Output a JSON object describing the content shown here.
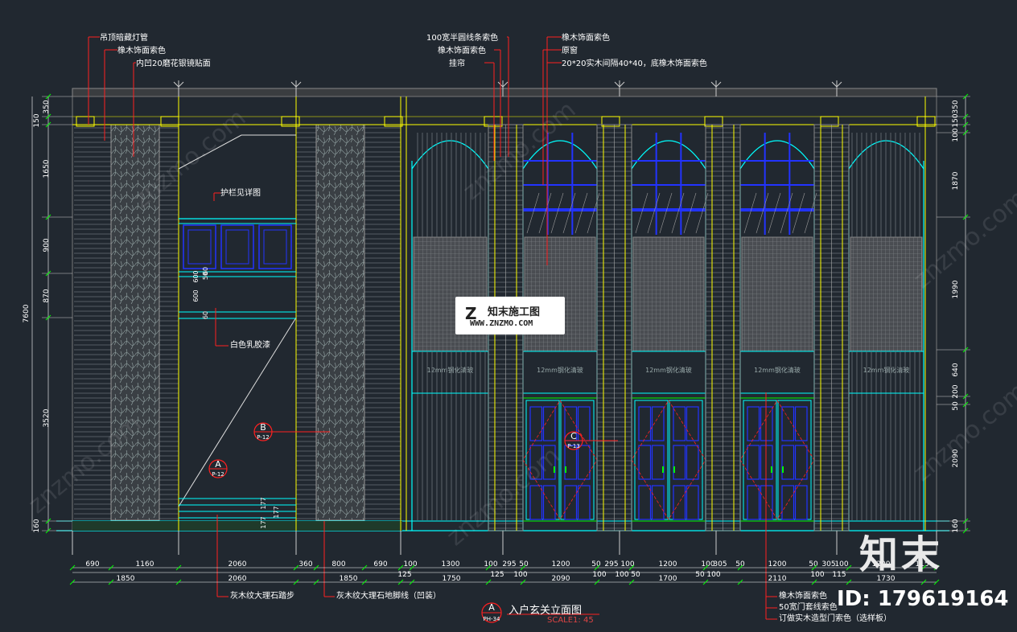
{
  "labels": {
    "ceiling_light": "吊顶暗藏灯管",
    "oak_paint_1": "橡木饰面索色",
    "mirror": "内凹20磨花银镜贴面",
    "half_round": "100宽半圆线条索色",
    "oak_paint_2": "橡木饰面索色",
    "curtain": "挂帘",
    "oak_paint_3": "橡木饰面索色",
    "original_window": "原窗",
    "grid": "20*20实木间隔40*40，底橡木饰面索色",
    "railing": "护栏见详图",
    "latex": "白色乳胶漆",
    "step": "灰木纹大理石踏步",
    "skirting": "灰木纹大理石地脚线（凹装）",
    "oak_bottom": "橡木饰面索色",
    "door_frame": "50宽门套线索色",
    "custom_door": "订做实木造型门索色（选样板）",
    "glass": "12mm钢化清玻"
  },
  "title": {
    "name": "入户玄关立面图",
    "scale": "SCALE1: 45",
    "marker_letter": "A",
    "marker_ref": "PH-34"
  },
  "markers": [
    {
      "letter": "B",
      "ref": "P-12"
    },
    {
      "letter": "A",
      "ref": "P-12"
    },
    {
      "letter": "C",
      "ref": "P-13"
    }
  ],
  "logo": {
    "mark": "Z",
    "name": "知末施工图",
    "url": "WWW.ZNZMO.COM"
  },
  "brand": "知末",
  "id_text": "ID: 179619164",
  "watermark": "znzmo.com",
  "left_dims": [
    "150",
    "350",
    "1650",
    "900",
    "870",
    "3520",
    "160",
    "7600"
  ],
  "right_dims": [
    "350",
    "150",
    "100",
    "1870",
    "1990",
    "640",
    "200",
    "50",
    "2090",
    "160"
  ],
  "inner_dims": [
    "600",
    "50",
    "60",
    "600",
    "60",
    "177",
    "177",
    "177"
  ],
  "bottom_row1": [
    "690",
    "1160",
    "2060",
    "360",
    "800",
    "690",
    "100",
    "1300",
    "100",
    "295",
    "50",
    "1200",
    "50",
    "295",
    "100",
    "1200",
    "100",
    "305",
    "50",
    "1200",
    "50",
    "305",
    "100",
    "1200",
    "115"
  ],
  "bottom_row2": [
    "125",
    "125",
    "100",
    "100",
    "100",
    "50",
    "50",
    "100",
    "100",
    "115"
  ],
  "bottom_row3": [
    "1850",
    "2060",
    "1850",
    "1750",
    "2090",
    "1700",
    "2110",
    "1730"
  ],
  "colors": {
    "background": "#212830",
    "yellow": "#ffff00",
    "cyan": "#00ffff",
    "blue": "#2233ff",
    "red": "#ff2020",
    "green": "#00ff00",
    "white": "#ffffff"
  }
}
